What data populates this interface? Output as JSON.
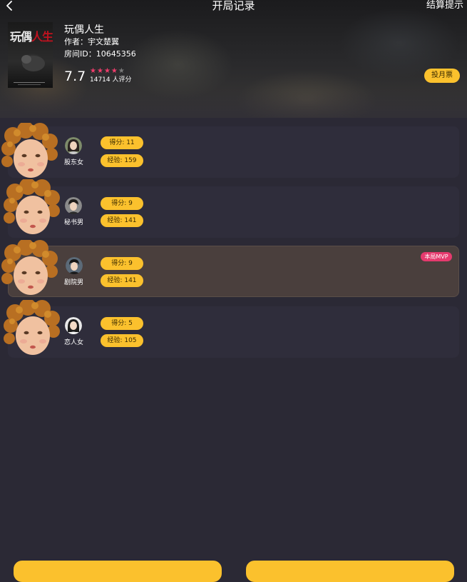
{
  "nav": {
    "title": "开局记录",
    "right_label": "结算提示",
    "back_icon": "chevron-left-icon"
  },
  "book": {
    "cover_title_line1": "玩偶",
    "cover_title_line2": "人生",
    "title": "玩偶人生",
    "author": "作者：宇文楚翼",
    "room_id": "房间ID：10645356",
    "rating": "7.7",
    "stars_filled": 4,
    "stars_total": 5,
    "rating_count": "14714 人评分",
    "vote_label": "投月票"
  },
  "players": [
    {
      "role": "股东女",
      "score": "得分: 11",
      "exp": "经验: 159",
      "mvp": false
    },
    {
      "role": "秘书男",
      "score": "得分: 9",
      "exp": "经验: 141",
      "mvp": false
    },
    {
      "role": "剧院男",
      "score": "得分: 9",
      "exp": "经验: 141",
      "mvp": true
    },
    {
      "role": "恋人女",
      "score": "得分: 5",
      "exp": "经验: 105",
      "mvp": false
    }
  ],
  "mvp_badge": "本局MVP",
  "colors": {
    "background": "#2b2935",
    "row": "#2f2d3b",
    "mvp_row": "#4a3f3d",
    "accent": "#fbc12d",
    "star": "#ef3c6b",
    "mvp_badge": "#e53a6e"
  }
}
